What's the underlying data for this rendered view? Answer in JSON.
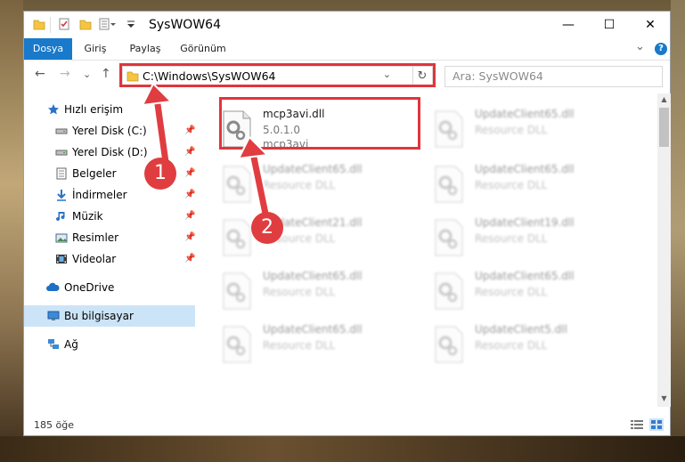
{
  "window": {
    "title": "SysWOW64"
  },
  "window_controls": {
    "minimize": "—",
    "maximize": "☐",
    "close": "✕"
  },
  "ribbon": {
    "tabs": [
      "Dosya",
      "Giriş",
      "Paylaş",
      "Görünüm"
    ],
    "help": "?",
    "collapse": "⌄"
  },
  "nav": {
    "back": "←",
    "forward": "→",
    "recent": "⌄",
    "up": "↑"
  },
  "address": {
    "path": "C:\\Windows\\SysWOW64",
    "dropdown": "⌄",
    "refresh": "↻"
  },
  "search": {
    "placeholder": "Ara: SysWOW64"
  },
  "sidebar": {
    "items": [
      {
        "label": "Hızlı erişim"
      },
      {
        "label": "Yerel Disk (C:)"
      },
      {
        "label": "Yerel Disk (D:)"
      },
      {
        "label": "Belgeler"
      },
      {
        "label": "İndirmeler"
      },
      {
        "label": "Müzik"
      },
      {
        "label": "Resimler"
      },
      {
        "label": "Videolar"
      },
      {
        "label": "OneDrive"
      },
      {
        "label": "Bu bilgisayar"
      },
      {
        "label": "Ağ"
      }
    ]
  },
  "files": [
    {
      "name": "mcp3avi.dll",
      "line2": "5.0.1.0",
      "line3": "mcp3avi"
    },
    {
      "name": "UpdateClient65.dll",
      "line2": "Resource DLL"
    },
    {
      "name": "UpdateClient65.dll",
      "line2": "Resource DLL"
    },
    {
      "name": "UpdateClient65.dll",
      "line2": "Resource DLL"
    },
    {
      "name": "UpdateClient21.dll",
      "line2": "Resource DLL"
    },
    {
      "name": "UpdateClient19.dll",
      "line2": "Resource DLL"
    },
    {
      "name": "UpdateClient65.dll",
      "line2": "Resource DLL"
    },
    {
      "name": "UpdateClient65.dll",
      "line2": "Resource DLL"
    },
    {
      "name": "UpdateClient65.dll",
      "line2": "Resource DLL"
    },
    {
      "name": "UpdateClient5.dll",
      "line2": "Resource DLL"
    }
  ],
  "status": {
    "count": "185 öğe"
  },
  "callouts": {
    "one": "1",
    "two": "2"
  },
  "colors": {
    "accent": "#1979ca",
    "highlight": "#e0353c",
    "selected": "#cce4f7"
  }
}
